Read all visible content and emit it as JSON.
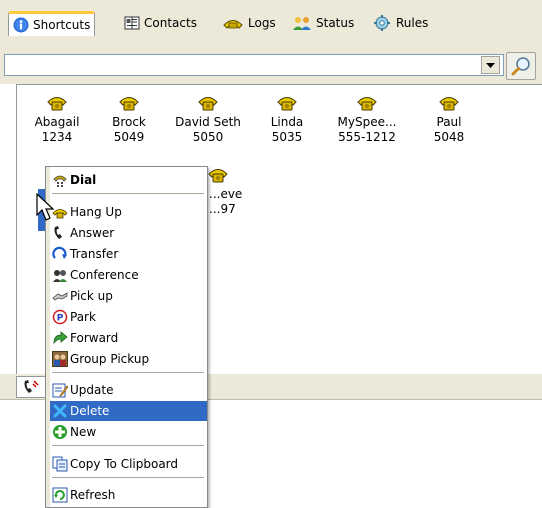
{
  "tabs": [
    {
      "label": "Shortcuts",
      "icon": "info-icon",
      "active": true
    },
    {
      "label": "Contacts",
      "icon": "address-book-icon"
    },
    {
      "label": "Logs",
      "icon": "phone-log-icon"
    },
    {
      "label": "Status",
      "icon": "people-status-icon"
    },
    {
      "label": "Rules",
      "icon": "rules-gear-icon"
    }
  ],
  "search": {
    "value": "",
    "placeholder": ""
  },
  "contacts": [
    {
      "name": "Abagail",
      "number": "1234"
    },
    {
      "name": "Brock",
      "number": "5049"
    },
    {
      "name": "David Seth",
      "number": "5050"
    },
    {
      "name": "Linda",
      "number": "5035"
    },
    {
      "name": "MySpee...",
      "number": "555-1212"
    },
    {
      "name": "Paul",
      "number": "5048"
    },
    {
      "name": "...eve",
      "number": "...97"
    }
  ],
  "context_menu": {
    "items": [
      {
        "label": "Dial",
        "icon": "dial-icon",
        "bold": true
      },
      {
        "label": "Hang Up",
        "icon": "hang-up-icon"
      },
      {
        "label": "Answer",
        "icon": "answer-icon"
      },
      {
        "label": "Transfer",
        "icon": "transfer-icon"
      },
      {
        "label": "Conference",
        "icon": "conference-icon"
      },
      {
        "label": "Pick up",
        "icon": "pick-up-icon"
      },
      {
        "label": "Park",
        "icon": "park-icon"
      },
      {
        "label": "Forward",
        "icon": "forward-icon"
      },
      {
        "label": "Group Pickup",
        "icon": "group-pickup-icon"
      },
      {
        "label": "Update",
        "icon": "update-icon"
      },
      {
        "label": "Delete",
        "icon": "delete-icon",
        "highlighted": true
      },
      {
        "label": "New",
        "icon": "new-icon"
      },
      {
        "label": "Copy To Clipboard",
        "icon": "clipboard-icon"
      },
      {
        "label": "Refresh",
        "icon": "refresh-icon"
      }
    ]
  },
  "colors": {
    "chrome": "#ece9d8",
    "highlight": "#316ac5",
    "active_tab_accent": "#ffc83c",
    "phone_yellow": "#e8c800"
  }
}
